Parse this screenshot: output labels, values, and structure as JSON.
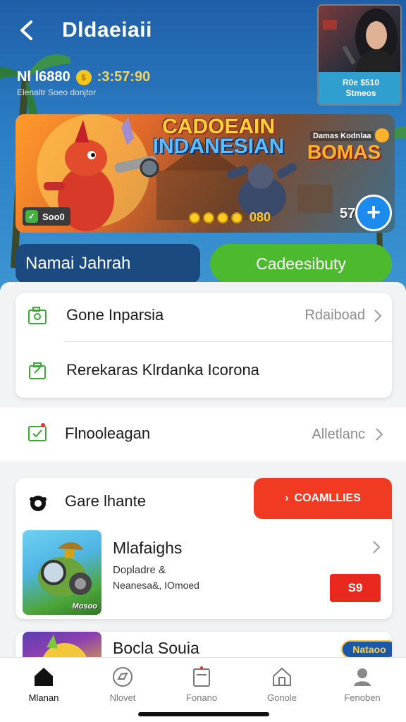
{
  "header": {
    "title": "Dldaeiaii",
    "timer_label": "Nl l6880",
    "timer_value": ":3:57:90",
    "sub_caption": "Elenaltr Soeo donjtor"
  },
  "live_card": {
    "caption_line1": "R0e $510",
    "caption_line2": "Stmeos"
  },
  "banner": {
    "title_line1": "CADOEAIN",
    "title_line2": "INDANESIAN",
    "side_small": "Damas Kodnlaa",
    "side_title": "BOMAS",
    "badge_label": "Soo0",
    "coin_count": "080",
    "score": "573"
  },
  "actions": {
    "name_label": "Namai Jahrah",
    "cta_label": "Cadeesibuty"
  },
  "list_card": {
    "items": [
      {
        "label": "Gone Inparsia",
        "value": "Rdaiboad"
      },
      {
        "label": "Rerekaras Klrdanka Icorona",
        "value": ""
      }
    ]
  },
  "plain_row": {
    "label": "Flnooleagan",
    "value": "Alletlanc"
  },
  "game_section": {
    "header_label": "Gare lhante",
    "button_label": "COAMLLIES",
    "item": {
      "title": "Mlafaighs",
      "sub1": "Dopladre &",
      "sub2": "Neanesa&, IOmoed",
      "thumb_caption": "Mosoo",
      "price": "S9"
    },
    "peek_item": {
      "title": "Bocla Souia",
      "badge": "Nataoo"
    }
  },
  "tabbar": {
    "tabs": [
      {
        "label": "Mlanan",
        "icon": "home-icon",
        "active": true
      },
      {
        "label": "Nlovet",
        "icon": "compass-icon",
        "active": false
      },
      {
        "label": "Fonano",
        "icon": "calendar-icon",
        "active": false
      },
      {
        "label": "Gonole",
        "icon": "house-outline-icon",
        "active": false
      },
      {
        "label": "Fenoben",
        "icon": "profile-icon",
        "active": false
      }
    ]
  },
  "colors": {
    "accent_green": "#4cb92e",
    "accent_red": "#f03a22",
    "accent_blue": "#1c8bf0",
    "header_blue": "#2b7ec4"
  }
}
